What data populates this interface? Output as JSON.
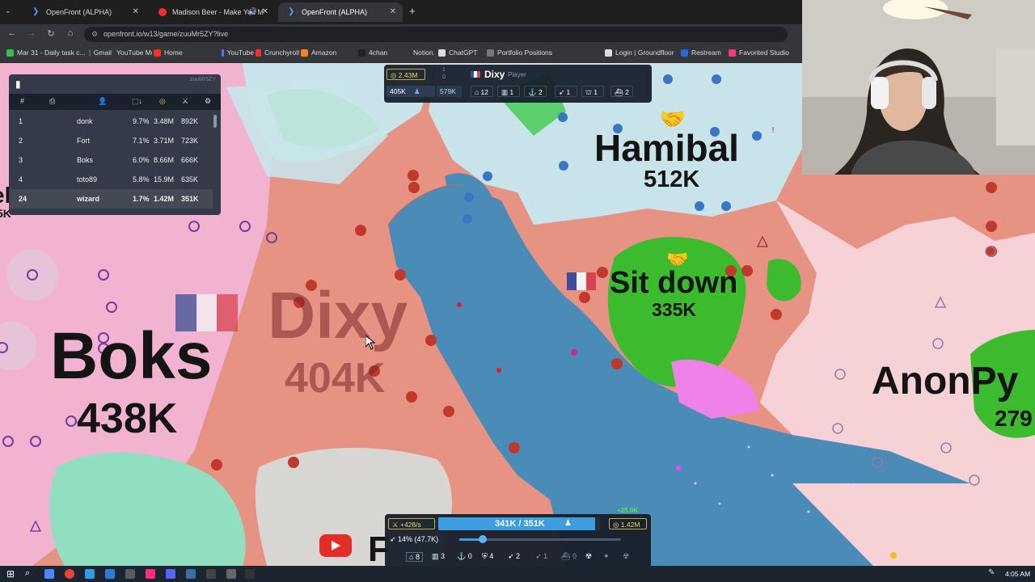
{
  "browser": {
    "tabs": [
      {
        "title": "OpenFront (ALPHA)",
        "active": false
      },
      {
        "title": "Madison Beer - Make You M",
        "active": false
      },
      {
        "title": "OpenFront (ALPHA)",
        "active": true
      }
    ],
    "url": "openfront.io/w13/game/zuuMr5ZY?live",
    "bookmarks": [
      "Mar 31 - Daily task c...",
      "Gmail",
      "YouTube Music",
      "Home",
      "YouTube",
      "Crunchyroll",
      "Amazon",
      "4chan",
      "Notion.so",
      "ChatGPT",
      "Portfolio Positions",
      "Login | Groundfloor",
      "Restream",
      "Favorited Studio"
    ]
  },
  "map": {
    "players": [
      {
        "name": "Boks",
        "troops": "438K"
      },
      {
        "name": "Dixy",
        "troops": "404K"
      },
      {
        "name": "Hamibal",
        "troops": "512K"
      },
      {
        "name": "Sit down",
        "troops": "335K"
      },
      {
        "name": "AnonPy",
        "troops": "279"
      }
    ],
    "partial_left": {
      "name": "el",
      "troops": "5K"
    },
    "bottom_partial": "F"
  },
  "leaderboard": {
    "game_code_watermark": "zuuMr5ZY",
    "headers": {
      "rank": "#"
    },
    "rows": [
      {
        "rank": "1",
        "name": "donk",
        "pct": "9.7%",
        "gold": "3.48M",
        "troops": "892K"
      },
      {
        "rank": "2",
        "name": "Fort",
        "pct": "7.1%",
        "gold": "3.71M",
        "troops": "723K"
      },
      {
        "rank": "3",
        "name": "Boks",
        "pct": "6.0%",
        "gold": "8.66M",
        "troops": "666K"
      },
      {
        "rank": "4",
        "name": "toto89",
        "pct": "5.8%",
        "gold": "15.9M",
        "troops": "635K"
      },
      {
        "rank": "24",
        "name": "wizard",
        "pct": "1.7%",
        "gold": "1.42M",
        "troops": "351K",
        "self": true
      }
    ]
  },
  "player_info": {
    "gold": "2.43M",
    "rank_a": "1",
    "rank_b": "0",
    "name": "Dixy",
    "type": "Player",
    "troops": "405K",
    "workers": "579K",
    "stats": [
      "12",
      "1",
      "2",
      "1",
      "1",
      "2"
    ]
  },
  "control": {
    "rate": "+428/s",
    "troop_count": "341K / 351K",
    "troop_fill": 0.97,
    "gold": "1.42M",
    "gold_gain": "+25.0K",
    "attack_ratio": "14% (47.7K)",
    "attack_fill": 0.14,
    "build_counts": [
      "8",
      "3",
      "0",
      "4",
      "2",
      "1",
      "0"
    ]
  },
  "taskbar": {
    "time": "4:05 AM"
  },
  "colors": {
    "ocean": "#4a8bb8",
    "dixy": "#e79383",
    "boks": "#f2b3d0",
    "hamibal": "#c8e4ea",
    "sitdown": "#3dbb2f",
    "anon": "#f6d2d6"
  }
}
